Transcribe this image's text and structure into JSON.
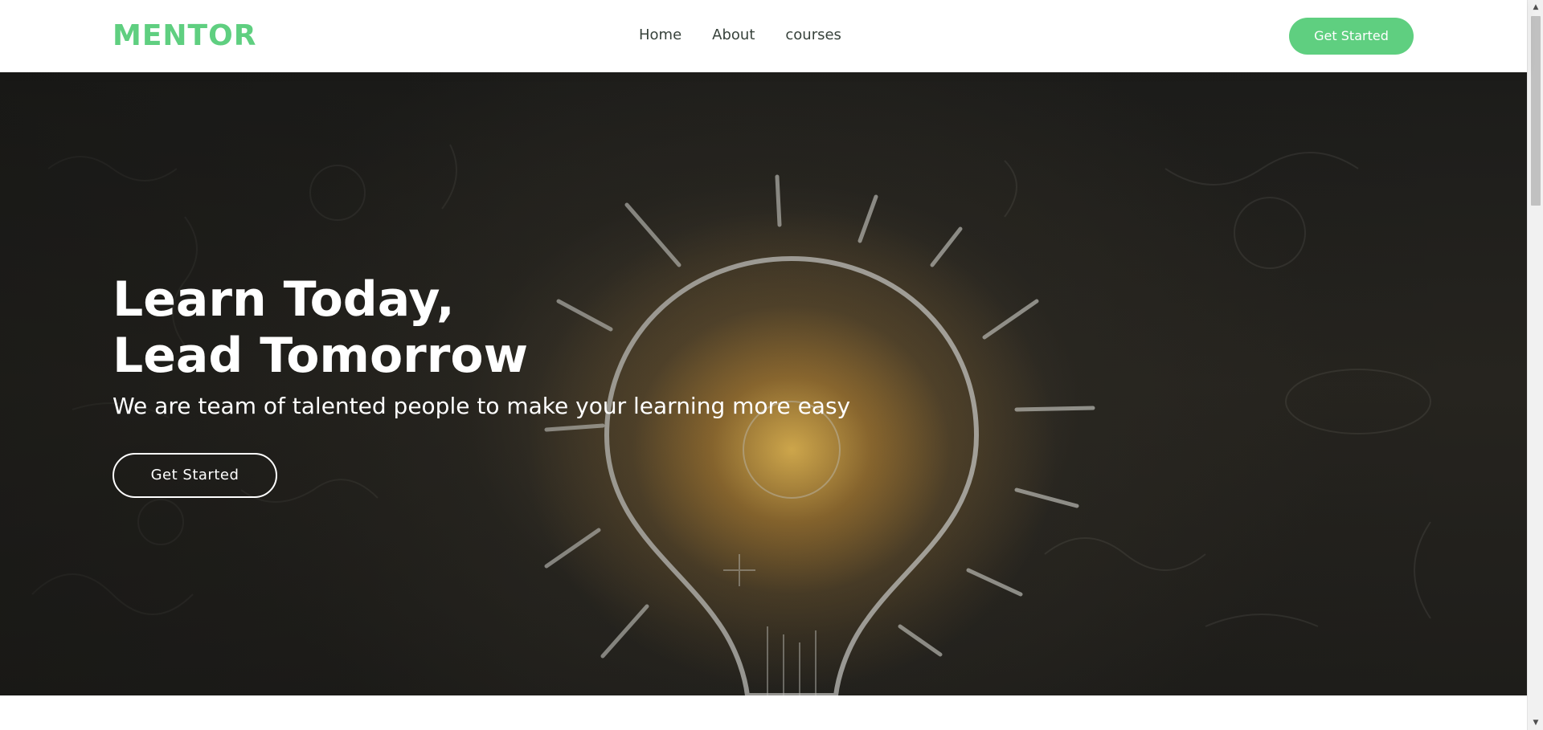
{
  "theme": {
    "accent": "#5fcf80",
    "text_dark": "#37423b"
  },
  "header": {
    "logo": "MENTOR",
    "nav": [
      {
        "label": "Home"
      },
      {
        "label": "About"
      },
      {
        "label": "courses"
      }
    ],
    "cta_label": "Get Started"
  },
  "hero": {
    "title_line1": "Learn Today,",
    "title_line2": "Lead Tomorrow",
    "subtitle": "We are team of talented people to make your learning more easy",
    "cta_label": "Get Started",
    "background_image": "lightbulb-chalkboard-illustration"
  },
  "scrollbar": {
    "up_icon": "chevron-up-icon",
    "down_icon": "chevron-down-icon"
  }
}
